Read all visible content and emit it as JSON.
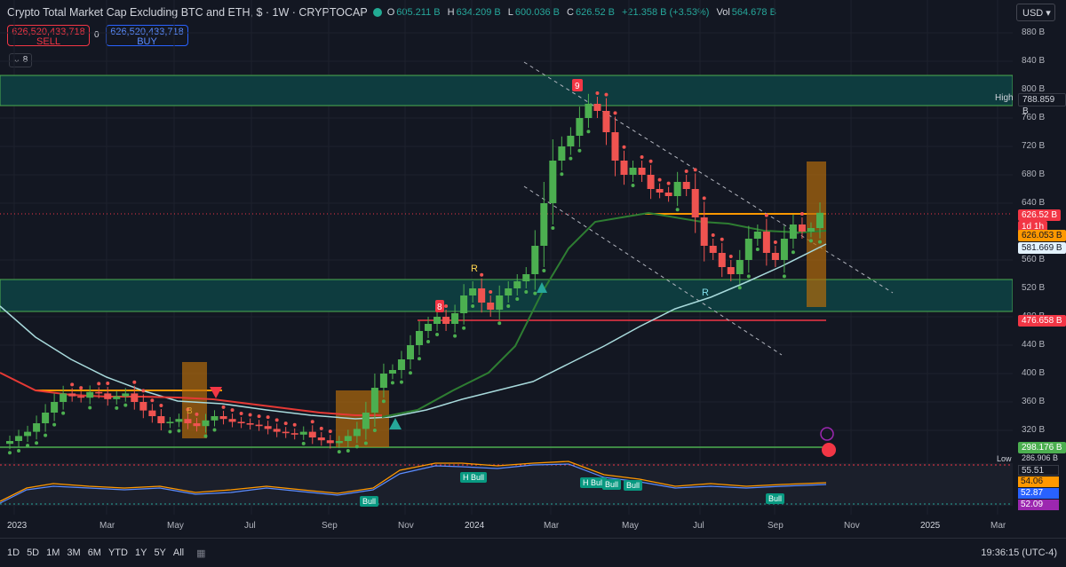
{
  "header": {
    "title": "Crypto Total Market Cap Excluding BTC and ETH, $ · 1W · CRYPTOCAP",
    "ohlc": [
      {
        "k": "O",
        "v": "605.211 B"
      },
      {
        "k": "H",
        "v": "634.209 B"
      },
      {
        "k": "L",
        "v": "600.036 B"
      },
      {
        "k": "C",
        "v": "626.52 B"
      },
      {
        "k": "",
        "v": "+21.358 B (+3.53%)"
      }
    ],
    "vol_label": "Vol",
    "vol_value": "564.678 B"
  },
  "trade": {
    "sell_price": "626,520,433,718",
    "sell_label": "SELL",
    "spread": "0",
    "buy_price": "626,520,433,718",
    "buy_label": "BUY"
  },
  "indicators_count": "8",
  "currency": "USD",
  "y_ticks": [
    "880 B",
    "840 B",
    "800 B",
    "760 B",
    "720 B",
    "680 B",
    "640 B",
    "560 B",
    "520 B",
    "480 B",
    "440 B",
    "400 B",
    "360 B",
    "320 B"
  ],
  "price_tags": {
    "high_label": "High",
    "high_value": "788.859 B",
    "current": "626.52 B",
    "current_sub": "1d 1h",
    "ema_orange": "626.053 B",
    "sma_blue": "581.669 B",
    "support_red": "476.658 B",
    "green_line": "298.176 B",
    "low_label": "Low",
    "low_value": "286.906 B"
  },
  "signals": {
    "r_label": "R",
    "b_label": "B",
    "nine": "9",
    "eight": "8"
  },
  "oscillator": {
    "values": [
      "55.51",
      "54.06",
      "52.87",
      "52.09"
    ],
    "bull_labels": [
      "Bull",
      "H Bull",
      "H Bull",
      "Bull",
      "Bull",
      "Bull"
    ]
  },
  "x_ticks": [
    "2023",
    "Mar",
    "May",
    "Jul",
    "Sep",
    "Nov",
    "2024",
    "Mar",
    "May",
    "Jul",
    "Sep",
    "Nov",
    "2025",
    "Mar"
  ],
  "timeframes": [
    "1D",
    "5D",
    "1M",
    "3M",
    "6M",
    "YTD",
    "1Y",
    "5Y",
    "All"
  ],
  "clock": "19:36:15 (UTC-4)",
  "colors": {
    "bg": "#131722",
    "up": "#26a69a",
    "up_green": "#4caf50",
    "down": "#ef5350",
    "orange": "#ff9800",
    "sky": "#a8dadc",
    "teal_zone": "#0e3c3f"
  },
  "chart_data": {
    "type": "candlestick",
    "ylim": [
      280,
      880
    ],
    "weeks": 92,
    "closes": [
      305,
      312,
      318,
      330,
      345,
      360,
      372,
      368,
      366,
      374,
      372,
      364,
      368,
      372,
      360,
      348,
      340,
      330,
      332,
      336,
      330,
      326,
      334,
      340,
      336,
      332,
      330,
      328,
      326,
      322,
      318,
      316,
      314,
      318,
      310,
      306,
      302,
      305,
      312,
      322,
      345,
      380,
      400,
      405,
      420,
      440,
      460,
      470,
      480,
      470,
      485,
      510,
      520,
      500,
      490,
      510,
      520,
      530,
      540,
      580,
      640,
      700,
      720,
      735,
      760,
      780,
      770,
      740,
      700,
      680,
      690,
      680,
      660,
      655,
      650,
      670,
      660,
      620,
      580,
      570,
      550,
      540,
      560,
      590,
      600,
      570,
      560,
      590,
      610,
      600,
      605,
      626.5
    ]
  }
}
